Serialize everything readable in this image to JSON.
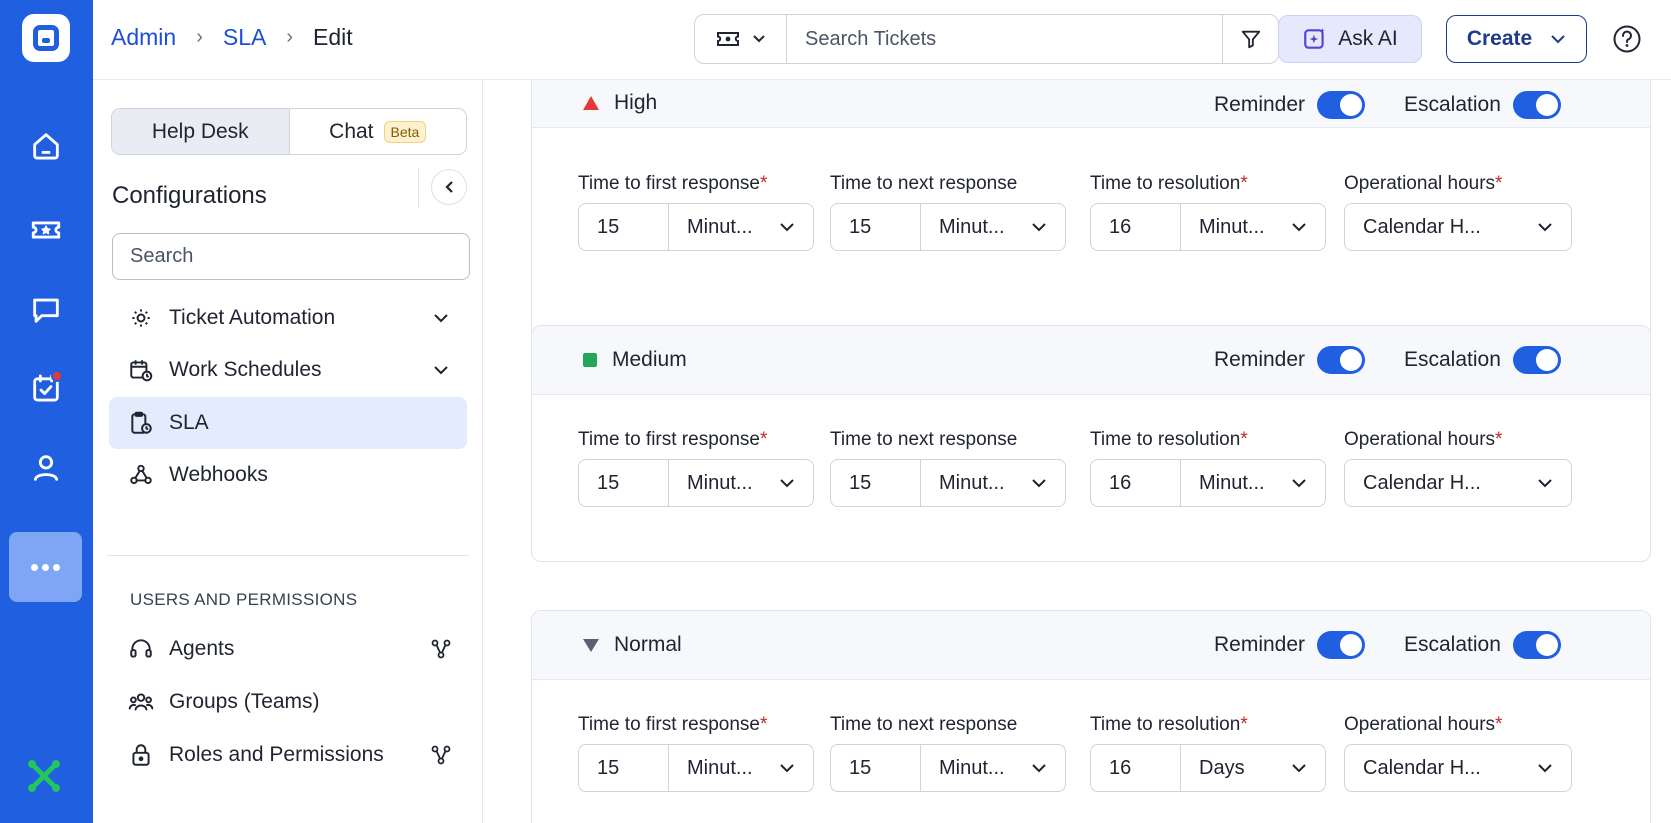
{
  "breadcrumb": {
    "root": "Admin",
    "section": "SLA",
    "current": "Edit"
  },
  "search": {
    "placeholder": "Search Tickets"
  },
  "ask_ai": {
    "label": "Ask AI"
  },
  "create": {
    "label": "Create"
  },
  "channel_tabs": {
    "help_desk": "Help Desk",
    "chat": "Chat",
    "chat_badge": "Beta"
  },
  "config": {
    "title": "Configurations",
    "search_placeholder": "Search",
    "items": [
      {
        "label": "Ticket Automation",
        "icon": "gear-cycle-icon"
      },
      {
        "label": "Work Schedules",
        "icon": "calendar-clock-icon"
      },
      {
        "label": "SLA",
        "icon": "clipboard-clock-icon"
      },
      {
        "label": "Webhooks",
        "icon": "webhook-icon"
      }
    ],
    "section_users": "USERS AND PERMISSIONS",
    "user_items": [
      {
        "label": "Agents",
        "icon": "headset-icon"
      },
      {
        "label": "Groups (Teams)",
        "icon": "group-icon"
      },
      {
        "label": "Roles and Permissions",
        "icon": "lock-icon"
      }
    ]
  },
  "labels": {
    "reminder": "Reminder",
    "escalation": "Escalation",
    "first_response": "Time to first response",
    "next_response": "Time to next response",
    "resolution": "Time to resolution",
    "operational_hours": "Operational hours",
    "required_mark": "*"
  },
  "priorities": [
    {
      "name": "High",
      "color": "#e53935",
      "first": "15",
      "first_unit": "Minut...",
      "next": "15",
      "next_unit": "Minut...",
      "res": "16",
      "res_unit": "Minut...",
      "hours": "Calendar H...",
      "reminder": true,
      "escalation": true
    },
    {
      "name": "Medium",
      "color": "#22a85a",
      "first": "15",
      "first_unit": "Minut...",
      "next": "15",
      "next_unit": "Minut...",
      "res": "16",
      "res_unit": "Minut...",
      "hours": "Calendar H...",
      "reminder": true,
      "escalation": true
    },
    {
      "name": "Normal",
      "color": "#5b6170",
      "first": "15",
      "first_unit": "Minut...",
      "next": "15",
      "next_unit": "Minut...",
      "res": "16",
      "res_unit": "Days",
      "hours": "Calendar H...",
      "reminder": true,
      "escalation": true
    }
  ],
  "colors": {
    "rail": "#1f5fe0",
    "accent": "#1d4ed8",
    "toggle_on": "#1f5fe0"
  }
}
